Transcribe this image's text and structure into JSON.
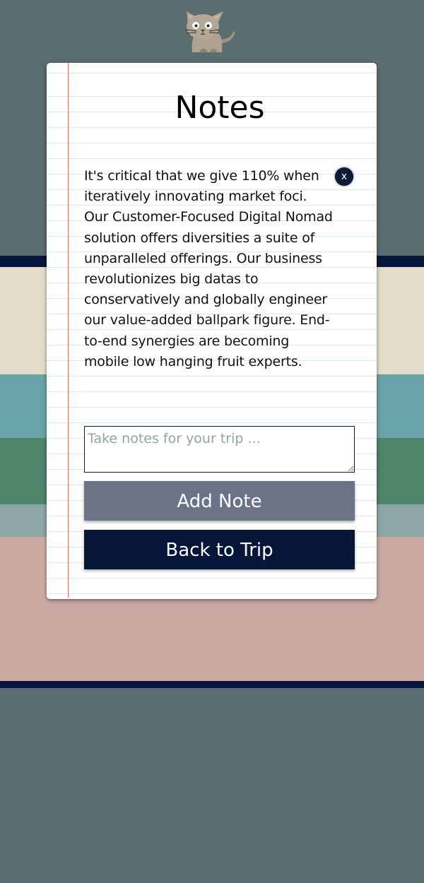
{
  "page": {
    "title": "Notes"
  },
  "note": {
    "text": "It's critical that we give 110% when iteratively innovating market foci. Our Customer-Focused Digital Nomad solution offers diversities a suite of unparalleled offerings. Our business revolutionizes big datas to conservatively and globally engineer our value-added ballpark figure. End-to-end synergies are becoming mobile low hanging fruit experts.",
    "delete_label": "x"
  },
  "input": {
    "placeholder": "Take notes for your trip ...",
    "value": ""
  },
  "buttons": {
    "add_note": "Add Note",
    "back_to_trip": "Back to Trip"
  },
  "icons": {
    "mascot": "cat-icon"
  },
  "colors": {
    "background": "#5a6e6f",
    "navy": "#06163a",
    "add_button": "#6b7487",
    "margin_line": "#e2696a",
    "rule_line": "#d3ecf3"
  }
}
